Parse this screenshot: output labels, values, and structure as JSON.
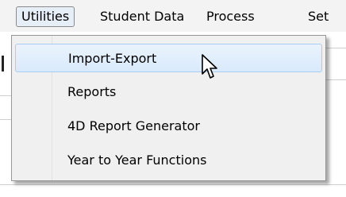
{
  "menubar": {
    "items": [
      {
        "label": "Utilities"
      },
      {
        "label": "Student Data"
      },
      {
        "label": "Process"
      },
      {
        "label": "Set"
      }
    ]
  },
  "dropdown": {
    "items": [
      {
        "label": "Import-Export"
      },
      {
        "label": "Reports"
      },
      {
        "label": "4D Report Generator"
      },
      {
        "label": "Year to Year Functions"
      }
    ]
  },
  "colors": {
    "hover_bg": "#d9eafb",
    "hover_border": "#a8cdf0",
    "menu_bg": "#f0f0f0"
  }
}
